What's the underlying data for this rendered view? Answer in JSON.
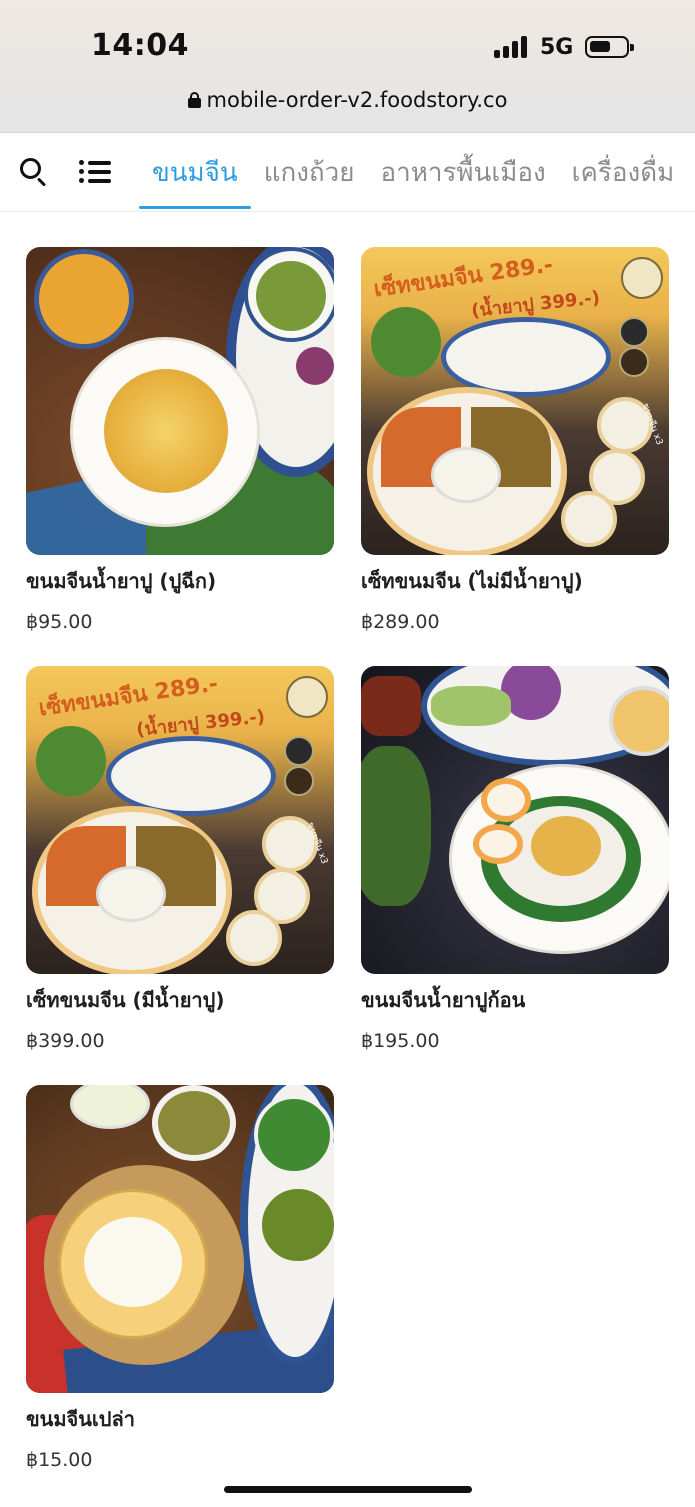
{
  "status_bar": {
    "time": "14:04",
    "network": "5G"
  },
  "browser": {
    "url": "mobile-order-v2.foodstory.co"
  },
  "categories": [
    {
      "label": "ขนมจีน"
    },
    {
      "label": "แกงถ้วย"
    },
    {
      "label": "อาหารพื้นเมือง"
    },
    {
      "label": "เครื่องดื่ม"
    }
  ],
  "active_category": "ขนมจีน",
  "products": [
    {
      "name": "ขนมจีนน้ำยาปู (ปูฉีก)",
      "price": "฿95.00",
      "image_text": []
    },
    {
      "name": "เซ็ทขนมจีน (ไม่มีน้ำยาปู)",
      "price": "฿289.00",
      "image_text": [
        "เซ็ทขนมจีน 289.-",
        "(น้ำยาปู 399.-)",
        "ขนมจีน x3"
      ]
    },
    {
      "name": "เซ็ทขนมจีน (มีน้ำยาปู)",
      "price": "฿399.00",
      "image_text": [
        "เซ็ทขนมจีน 289.-",
        "(น้ำยาปู 399.-)",
        "ขนมจีน x3"
      ]
    },
    {
      "name": "ขนมจีนน้ำยาปูก้อน",
      "price": "฿195.00",
      "image_text": []
    },
    {
      "name": "ขนมจีนเปล่า",
      "price": "฿15.00",
      "image_text": []
    }
  ],
  "icons": [
    "search-icon",
    "list-menu-icon",
    "lock-icon",
    "signal-icon",
    "battery-icon"
  ]
}
